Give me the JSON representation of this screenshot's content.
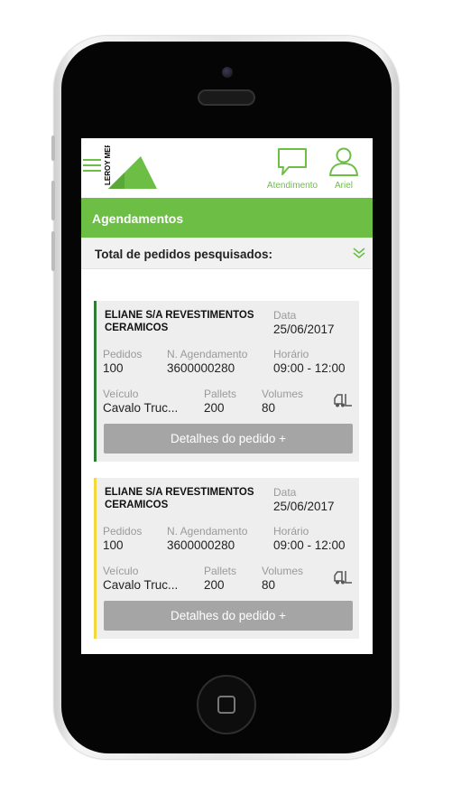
{
  "colors": {
    "brand_green": "#6cbe45",
    "card_border_1": "#2e7d32",
    "card_border_2": "#f4d83a"
  },
  "header": {
    "logo_text": "LEROY MERLIN",
    "menu_icon": "hamburger-icon",
    "support": {
      "label": "Atendimento",
      "icon": "chat-bubble-icon"
    },
    "user": {
      "label": "Ariel",
      "icon": "user-icon"
    }
  },
  "page_title": "Agendamentos",
  "total_label": "Total de pedidos pesquisados:",
  "labels": {
    "data": "Data",
    "pedidos": "Pedidos",
    "agendamento": "N. Agendamento",
    "horario": "Horário",
    "veiculo": "Veículo",
    "pallets": "Pallets",
    "volumes": "Volumes"
  },
  "orders": [
    {
      "company": "ELIANE S/A REVESTIMENTOS CERAMICOS",
      "date": "25/06/2017",
      "pedidos": "100",
      "agendamento": "3600000280",
      "horario": "09:00 - 12:00",
      "veiculo": "Cavalo Truc...",
      "pallets": "200",
      "volumes": "80",
      "button": "Detalhes do pedido  +"
    },
    {
      "company": "ELIANE S/A REVESTIMENTOS CERAMICOS",
      "date": "25/06/2017",
      "pedidos": "100",
      "agendamento": "3600000280",
      "horario": "09:00 - 12:00",
      "veiculo": "Cavalo Truc...",
      "pallets": "200",
      "volumes": "80",
      "button": "Detalhes do pedido  +"
    }
  ]
}
